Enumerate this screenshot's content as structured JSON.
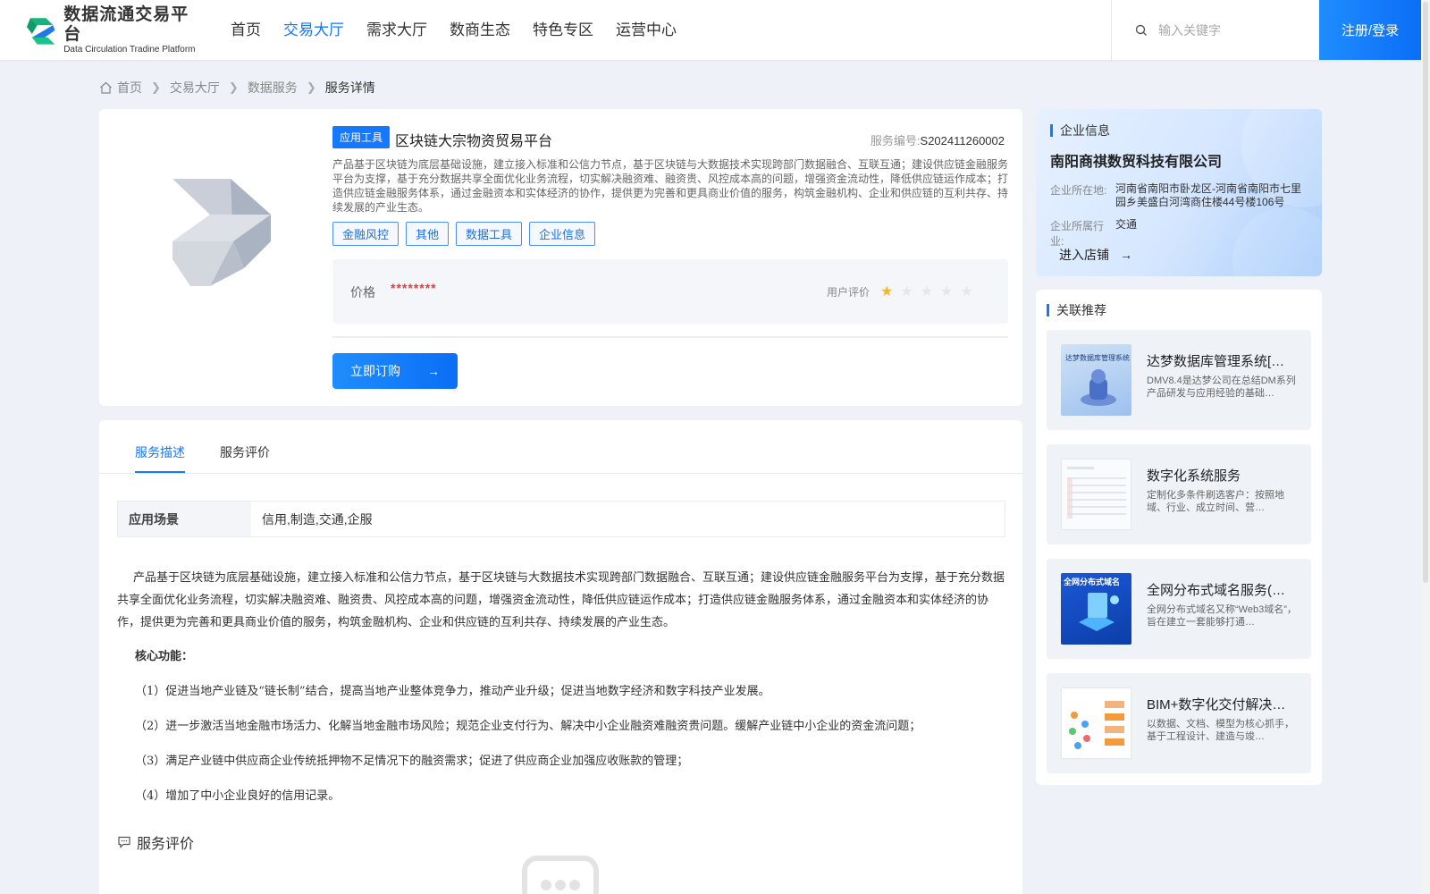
{
  "header": {
    "logo_cn": "数据流通交易平台",
    "logo_en": "Data Circulation Tradine Platform",
    "nav": [
      "首页",
      "交易大厅",
      "需求大厅",
      "数商生态",
      "特色专区",
      "运营中心"
    ],
    "nav_active_index": 1,
    "search_placeholder": "输入关键字",
    "login_label": "注册/登录",
    "accent_color": "#1677ff"
  },
  "breadcrumb": {
    "home": "首页",
    "level1": "交易大厅",
    "level2": "数据服务",
    "current": "服务详情"
  },
  "product": {
    "category_tag": "应用工具",
    "title": "区块链大宗物资贸易平台",
    "service_no_label": "服务编号:",
    "service_no": "S202411260002",
    "description": "产品基于区块链为底层基础设施，建立接入标准和公信力节点，基于区块链与大数据技术实现跨部门数据融合、互联互通；建设供应链金融服务平台为支撑，基于充分数据共享全面优化业务流程，切实解决融资难、融资贵、风控成本高的问题，增强资金流动性，降低供应链运作成本；打造供应链金融服务体系，通过金融资本和实体经济的协作，提供更为完善和更具商业价值的服务，构筑金融机构、企业和供应链的互利共存、持续发展的产业生态。",
    "tags": [
      "金融风控",
      "其他",
      "数据工具",
      "企业信息"
    ],
    "price_label": "价格",
    "price_value": "********",
    "rating_label": "用户评价",
    "rating_value": 1,
    "rating_max": 5,
    "order_label": "立即订购"
  },
  "company": {
    "section_title": "企业信息",
    "name": "南阳商祺数贸科技有限公司",
    "location_label": "企业所在地:",
    "location": "河南省南阳市卧龙区-河南省南阳市七里园乡美盛白河湾商住楼44号楼106号",
    "industry_label": "企业所属行业:",
    "industry": "交通",
    "shop_label": "进入店铺"
  },
  "recommend": {
    "section_title": "关联推荐",
    "items": [
      {
        "title": "达梦数据库管理系统[…",
        "desc": "DMV8.4是达梦公司在总结DM系列产品研发与应用经验的基础…",
        "thumb_text": "达梦数据库管理系统"
      },
      {
        "title": "数字化系统服务",
        "desc": "定制化多条件刷选客户：按照地域、行业、成立时间、营…",
        "thumb_text": ""
      },
      {
        "title": "全网分布式域名服务(…",
        "desc": "全网分布式域名又称“Web3域名”，旨在建立一套能够打通…",
        "thumb_text": "全网分布式域名"
      },
      {
        "title": "BIM+数字化交付解决…",
        "desc": "以数据、文档、模型为核心抓手，基于工程设计、建造与竣…",
        "thumb_text": ""
      }
    ]
  },
  "detail": {
    "tabs": [
      "服务描述",
      "服务评价"
    ],
    "active_tab": 0,
    "scene_label": "应用场景",
    "scene_value": "信用,制造,交通,企服",
    "paragraph": "产品基于区块链为底层基础设施，建立接入标准和公信力节点，基于区块链与大数据技术实现跨部门数据融合、互联互通；建设供应链金融服务平台为支撑，基于充分数据共享全面优化业务流程，切实解决融资难、融资贵、风控成本高的问题，增强资金流动性，降低供应链运作成本；打造供应链金融服务体系，通过金融资本和实体经济的协作，提供更为完善和更具商业价值的服务，构筑金融机构、企业和供应链的互利共存、持续发展的产业生态。",
    "core_label": "核心功能：",
    "features": [
      "（1）促进当地产业链及“链长制”结合，提高当地产业整体竞争力，推动产业升级；促进当地数字经济和数字科技产业发展。",
      "（2）进一步激活当地金融市场活力、化解当地金融市场风险；规范企业支付行为、解决中小企业融资难融资贵问题。缓解产业链中小企业的资金流问题；",
      "（3）满足产业链中供应商企业传统抵押物不足情况下的融资需求；促进了供应商企业加强应收账款的管理；",
      "（4）增加了中小企业良好的信用记录。"
    ],
    "review_title": "服务评价"
  }
}
